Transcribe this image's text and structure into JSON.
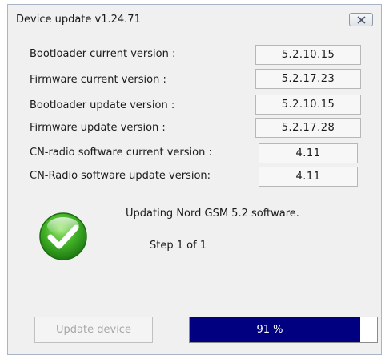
{
  "window": {
    "title": "Device update v1.24.71"
  },
  "versions": [
    {
      "label": "Bootloader current version :",
      "value": "5.2.10.15"
    },
    {
      "label": "Firmware current version :",
      "value": "5.2.17.23"
    },
    {
      "label": "Bootloader update version :",
      "value": "5.2.10.15"
    },
    {
      "label": "Firmware update version :",
      "value": "5.2.17.28"
    },
    {
      "label": "CN-radio software current version :",
      "value": "4.11"
    },
    {
      "label": "CN-Radio software update version:",
      "value": "4.11"
    }
  ],
  "status": {
    "icon": "success-check-icon",
    "message": "Updating Nord GSM 5.2 software.",
    "step": "Step 1 of 1"
  },
  "actions": {
    "update_label": "Update device",
    "update_enabled": false
  },
  "progress": {
    "value": 0.91,
    "text": "91 %",
    "fill_color": "#000080"
  }
}
